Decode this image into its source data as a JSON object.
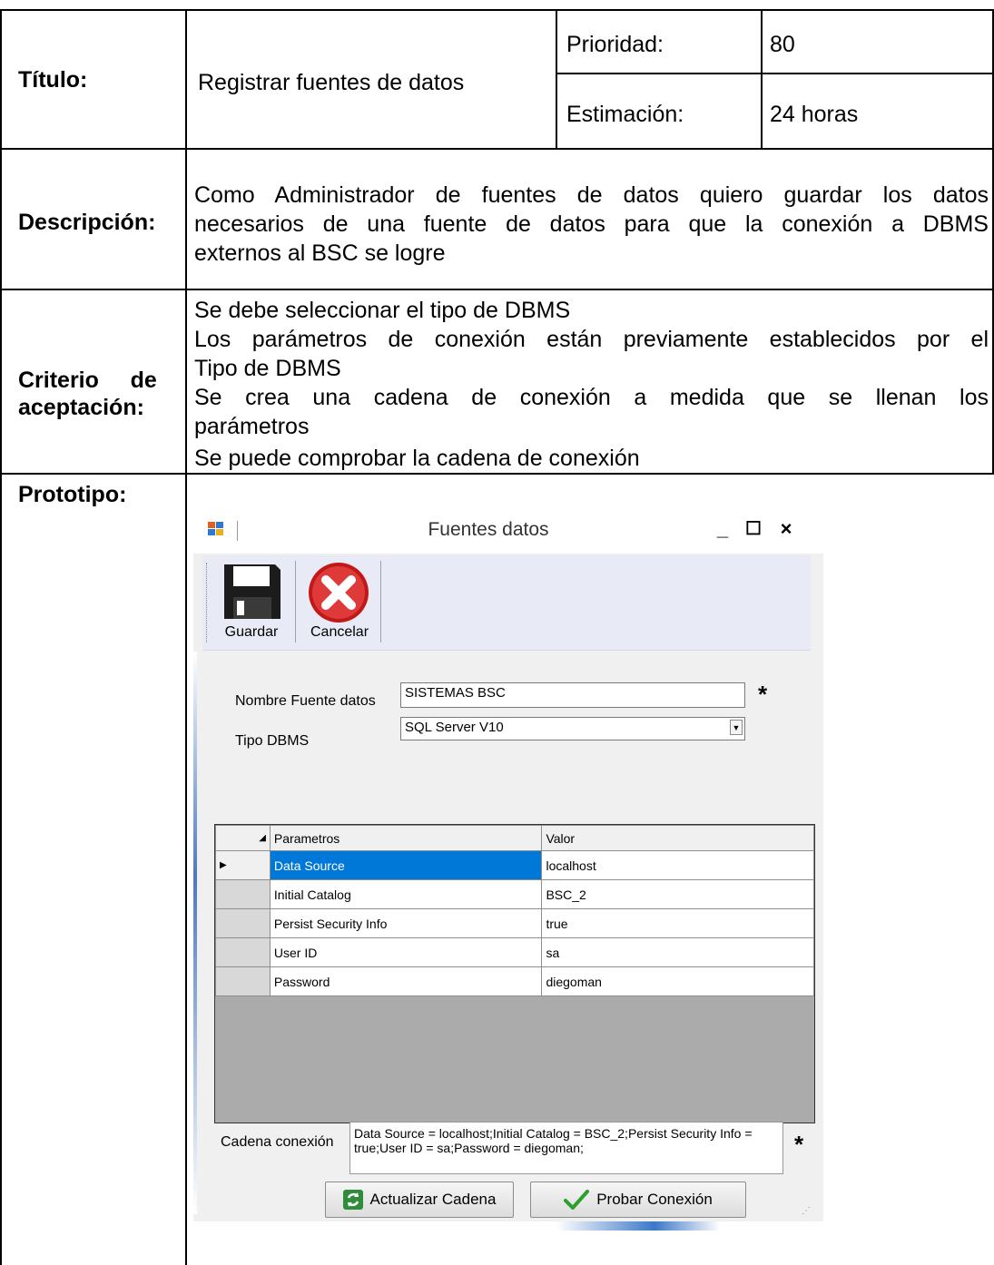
{
  "document": {
    "titulo_label": "Título:",
    "titulo_value": "Registrar fuentes de datos",
    "prioridad_label": "Prioridad:",
    "prioridad_value": "80",
    "estimacion_label": "Estimación:",
    "estimacion_value": "24 horas",
    "descripcion_label": "Descripción:",
    "descripcion_lines": [
      "Como Administrador de fuentes de datos quiero guardar los datos",
      "necesarios de una fuente de datos para que la conexión a DBMS",
      "externos al BSC se logre"
    ],
    "criterio_label_1": "Criterio     de",
    "criterio_label_2": "aceptación:",
    "criterio_lines": [
      "Se debe seleccionar el tipo de DBMS",
      "Los parámetros de conexión están previamente establecidos por el",
      "Tipo de DBMS",
      "Se crea una cadena de conexión a medida que se llenan los",
      "parámetros",
      "Se puede comprobar la cadena de conexión"
    ],
    "prototipo_label": "Prototipo:"
  },
  "window": {
    "title": "Fuentes datos",
    "minimize": "_",
    "maximize": "☐",
    "close": "×",
    "toolbar": {
      "save_label": "Guardar",
      "cancel_label": "Cancelar"
    },
    "form": {
      "nombre_label": "Nombre Fuente datos",
      "nombre_value": "SISTEMAS BSC",
      "tipo_label": "Tipo DBMS",
      "tipo_value": "SQL Server V10",
      "required_mark": "*",
      "grid": {
        "columns": [
          "Parametros",
          "Valor"
        ],
        "rows": [
          {
            "param": "Data Source",
            "value": "localhost"
          },
          {
            "param": "Initial Catalog",
            "value": "BSC_2"
          },
          {
            "param": "Persist Security Info",
            "value": "true"
          },
          {
            "param": "User ID",
            "value": "sa"
          },
          {
            "param": "Password",
            "value": "diegoman"
          }
        ]
      },
      "cadena_label": "Cadena conexión",
      "cadena_value": "Data Source = localhost;Initial Catalog = BSC_2;Persist Security Info = true;User ID = sa;Password = diegoman;",
      "update_button": "Actualizar Cadena",
      "test_button": "Probar Conexión"
    }
  },
  "icons": {
    "app": "app-icon",
    "save": "floppy-disk-icon",
    "cancel": "cancel-x-icon",
    "refresh": "refresh-icon",
    "check": "checkmark-icon",
    "row_pointer": "row-pointer-icon",
    "select_all": "grid-corner-triangle-icon"
  },
  "colors": {
    "selection": "#0078d7",
    "toolbar_bg": "#e8eaf6",
    "cancel_red": "#d02020",
    "check_green": "#2e9e2e"
  }
}
